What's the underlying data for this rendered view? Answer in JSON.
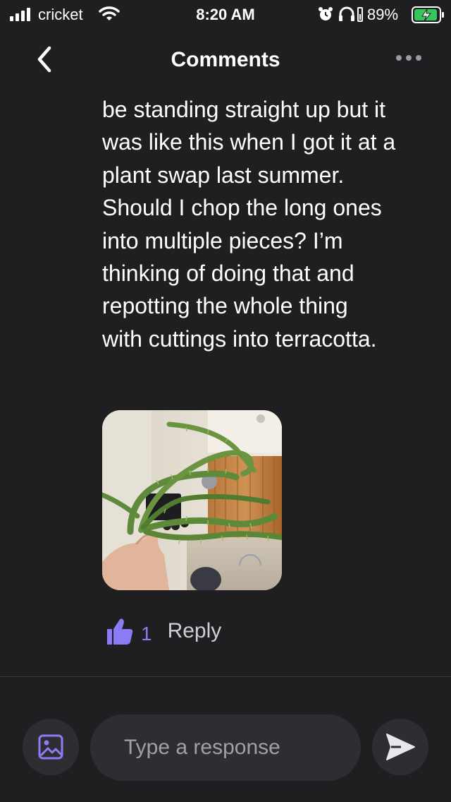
{
  "status_bar": {
    "carrier": "cricket",
    "time": "8:20 AM",
    "battery": "89%"
  },
  "nav": {
    "title": "Comments",
    "back_icon": "chevron-left-icon",
    "more_icon": "ellipsis-icon"
  },
  "comment": {
    "lines": [
      "be standing straight up but it",
      "was like this when I got it at a",
      "plant swap last summer.",
      "Should I chop the long ones",
      "into multiple pieces? I’m",
      "thinking of doing that and",
      "repotting the whole thing",
      "with cuttings into terracotta."
    ],
    "likes": "1",
    "reply_label": "Reply"
  },
  "composer": {
    "placeholder": "Type a response",
    "value": ""
  },
  "colors": {
    "background": "#1f1f21",
    "accent": "#8b7cf6",
    "battery": "#34c759"
  }
}
